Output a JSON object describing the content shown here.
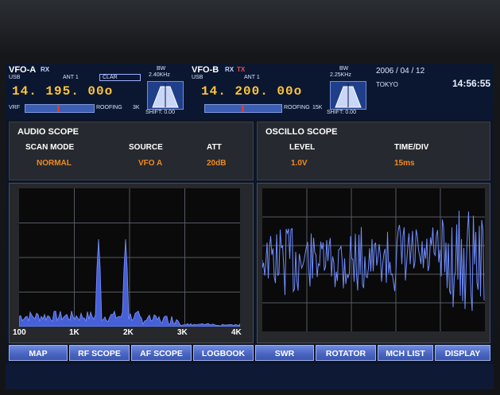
{
  "vfo_a": {
    "label": "VFO-A",
    "rx": "RX",
    "mode": "USB",
    "ant": "ANT 1",
    "clar": "CLAR",
    "frequency": "14. 195. 00o",
    "vrf": "VRF",
    "roofing": "ROOFING",
    "roofing_val": "3K",
    "bw_label": "BW",
    "bw_value": "2.40KHz",
    "shift": "SHIFT: 0.00"
  },
  "vfo_b": {
    "label": "VFO-B",
    "rx": "RX",
    "tx": "TX",
    "mode": "USB",
    "ant": "ANT 1",
    "frequency": "14. 200. 00o",
    "roofing": "ROOFING",
    "roofing_val": "15K",
    "bw_label": "BW",
    "bw_value": "2.25KHz",
    "shift": "SHIFT: 0.00"
  },
  "status": {
    "date": "2006 / 04 / 12",
    "location": "TOKYO",
    "time": "14:56:55"
  },
  "audio_scope": {
    "title": "AUDIO SCOPE",
    "columns": [
      {
        "head": "SCAN MODE",
        "value": "NORMAL"
      },
      {
        "head": "SOURCE",
        "value": "VFO A"
      },
      {
        "head": "ATT",
        "value": "20dB"
      }
    ],
    "x_ticks": [
      "100",
      "1K",
      "2K",
      "3K",
      "4K"
    ]
  },
  "oscillo_scope": {
    "title": "OSCILLO SCOPE",
    "columns": [
      {
        "head": "LEVEL",
        "value": "1.0V"
      },
      {
        "head": "TIME/DIV",
        "value": "15ms"
      }
    ]
  },
  "function_buttons": [
    "MAP",
    "RF SCOPE",
    "AF SCOPE",
    "LOGBOOK",
    "SWR",
    "ROTATOR",
    "MCH LIST",
    "DISPLAY"
  ],
  "colors": {
    "accent_orange": "#f08a22",
    "freq_yellow": "#ffc43a",
    "trace_blue": "#5a78f0",
    "button_blue": "#4a66c2"
  }
}
